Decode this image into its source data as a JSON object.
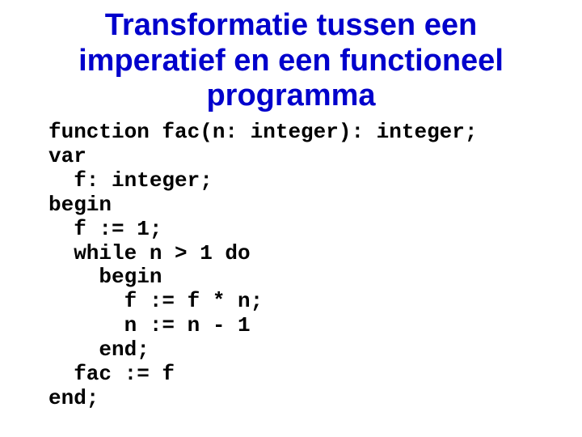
{
  "title": "Transformatie tussen een imperatief en een functioneel programma",
  "code": "function fac(n: integer): integer;\nvar\n  f: integer;\nbegin\n  f := 1;\n  while n > 1 do\n    begin\n      f := f * n;\n      n := n - 1\n    end;\n  fac := f\nend;"
}
